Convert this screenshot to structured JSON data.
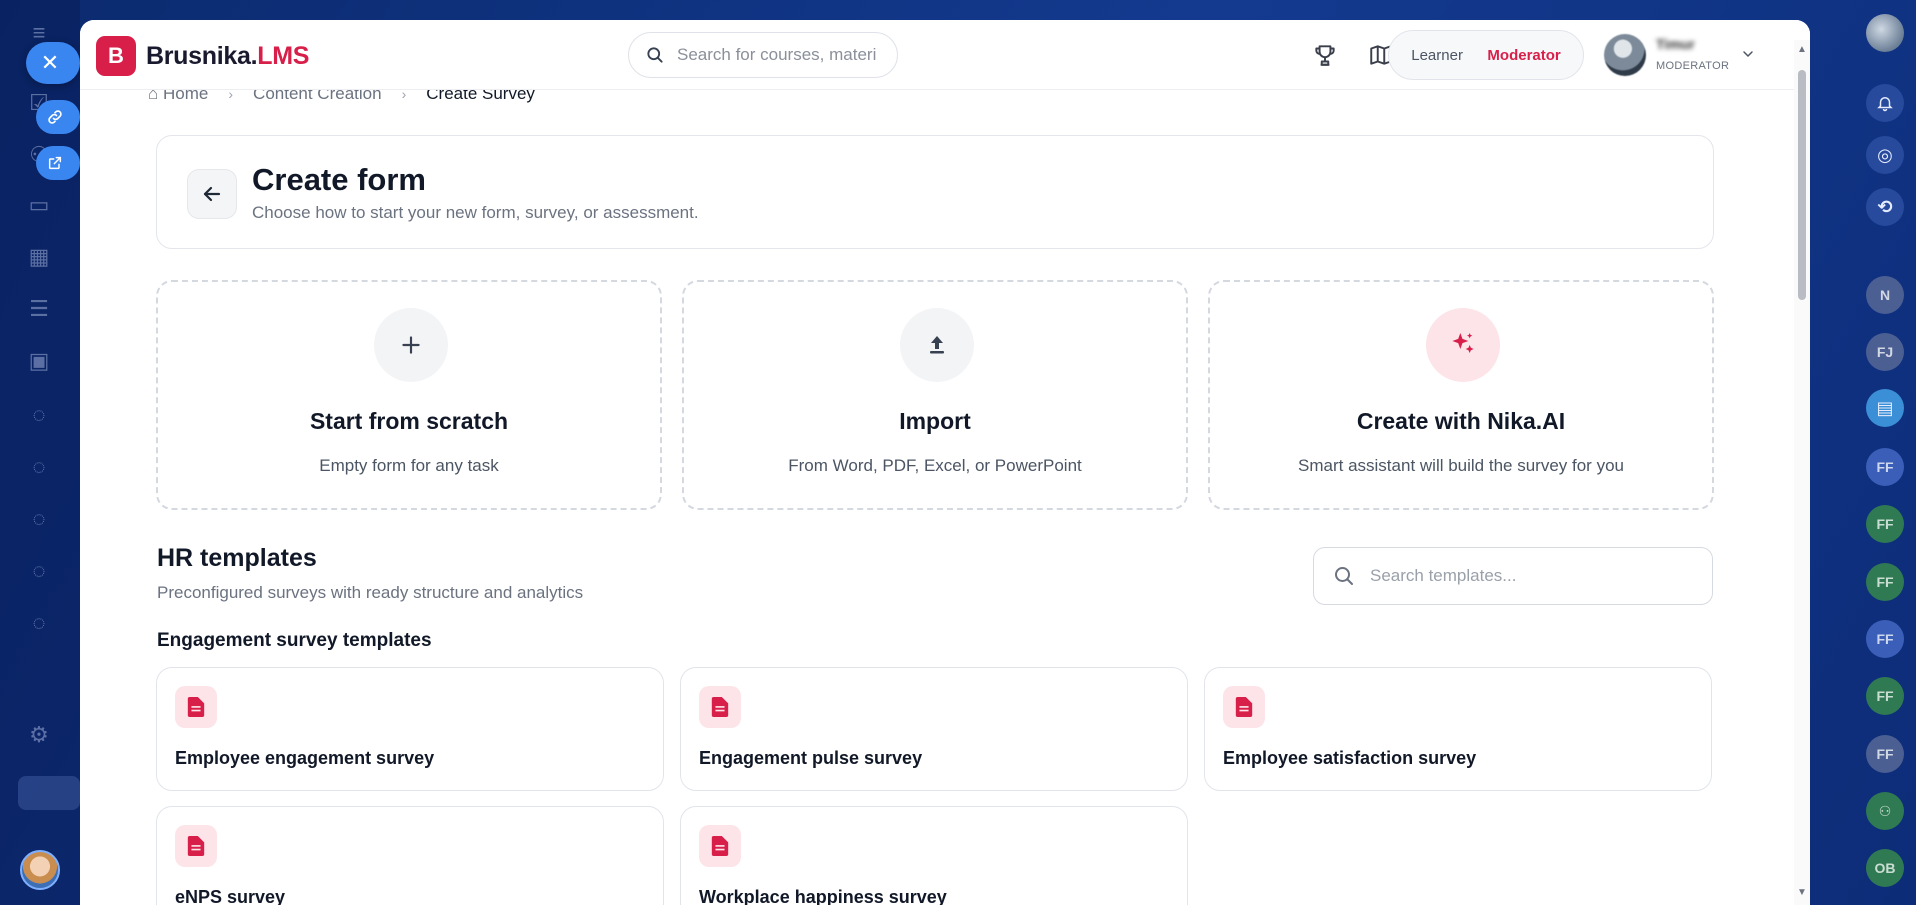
{
  "app": {
    "logo_letter": "B",
    "brand_name": "Brusnika.",
    "brand_suffix": "LMS",
    "brand_color": "#d81f4a"
  },
  "topbar": {
    "search_placeholder": "Search for courses, materi",
    "icons": [
      "trophy-icon",
      "map-icon",
      "support-headset-icon"
    ],
    "roles": {
      "learner_label": "Learner",
      "moderator_label": "Moderator",
      "active": "Moderator"
    },
    "user": {
      "name": "Timur",
      "role": "MODERATOR"
    }
  },
  "breadcrumb": {
    "home": "Home",
    "parent": "Content Creation",
    "current": "Create Survey"
  },
  "header": {
    "title": "Create form",
    "subtitle": "Choose how to start your new form, survey, or assessment."
  },
  "options": [
    {
      "title": "Start from scratch",
      "subtitle": "Empty form for any task",
      "icon": "plus-icon"
    },
    {
      "title": "Import",
      "subtitle": "From Word, PDF, Excel, or PowerPoint",
      "icon": "upload-icon"
    },
    {
      "title": "Create with Nika.AI",
      "subtitle": "Smart assistant will build the survey for you",
      "icon": "sparkles-icon"
    }
  ],
  "hr_templates": {
    "title": "HR templates",
    "subtitle": "Preconfigured surveys with ready structure and analytics",
    "search_placeholder": "Search templates...",
    "group_title": "Engagement survey templates",
    "templates": [
      "Employee engagement survey",
      "Engagement pulse survey",
      "Employee satisfaction survey",
      "eNPS survey",
      "Workplace happiness survey"
    ]
  },
  "right_rail": {
    "badges": [
      "N",
      "FJ",
      "FF",
      "FF",
      "FF",
      "FF",
      "FF",
      "FF",
      "OB"
    ]
  }
}
